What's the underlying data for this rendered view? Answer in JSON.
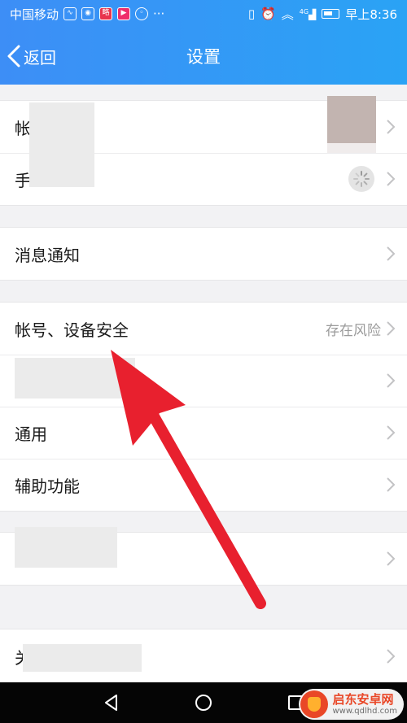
{
  "status_bar": {
    "carrier": "中国移动",
    "network": "4G",
    "time": "早上8:36"
  },
  "header": {
    "back_label": "返回",
    "title": "设置"
  },
  "groups": [
    {
      "rows": [
        {
          "label": "帐",
          "value": "",
          "redacted": true
        },
        {
          "label": "手",
          "value": "",
          "redacted": true
        }
      ]
    },
    {
      "rows": [
        {
          "label": "消息通知",
          "value": ""
        }
      ]
    },
    {
      "rows": [
        {
          "label": "帐号、设备安全",
          "value": "存在风险"
        },
        {
          "label": "",
          "value": "",
          "redacted": true
        },
        {
          "label": "通用",
          "value": ""
        },
        {
          "label": "辅助功能",
          "value": ""
        }
      ]
    },
    {
      "rows": [
        {
          "label": "",
          "value": "",
          "redacted": true
        }
      ]
    },
    {
      "rows": [
        {
          "label": "关",
          "value": "",
          "redacted": true
        }
      ]
    }
  ],
  "navigation": {
    "icons": [
      "back-triangle-icon",
      "home-circle-icon",
      "recents-square-icon"
    ]
  },
  "watermark": {
    "brand": "启东安卓网",
    "url": "www.qdlhd.com"
  },
  "colors": {
    "header_gradient_start": "#3d8ef6",
    "header_gradient_end": "#2aa3f5",
    "annotation_arrow": "#e8202e"
  }
}
